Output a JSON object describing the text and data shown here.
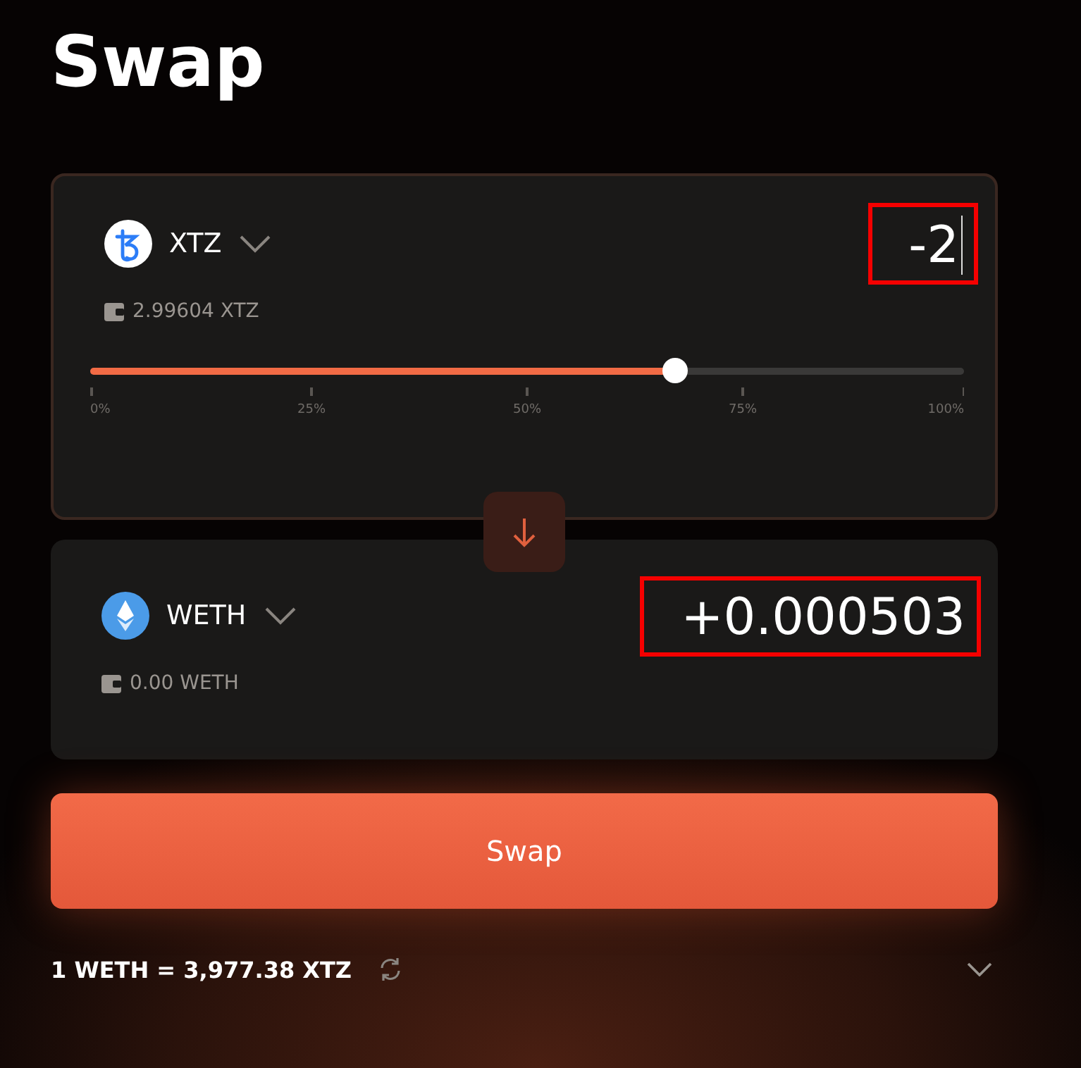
{
  "title": "Swap",
  "from": {
    "token": "XTZ",
    "kind": "tezos",
    "balance": "2.99604 XTZ",
    "amount": "-2",
    "highlighted": true,
    "focused": true,
    "slider": {
      "level": 0.67,
      "ticks": [
        "0%",
        "25%",
        "50%",
        "75%",
        "100%"
      ]
    }
  },
  "to": {
    "token": "WETH",
    "kind": "ether",
    "balance": "0.00 WETH",
    "amount": "+0.000503",
    "highlighted": true,
    "focused": false
  },
  "swap_button": "Swap",
  "rate": "1 WETH = 3,977.38 XTZ"
}
